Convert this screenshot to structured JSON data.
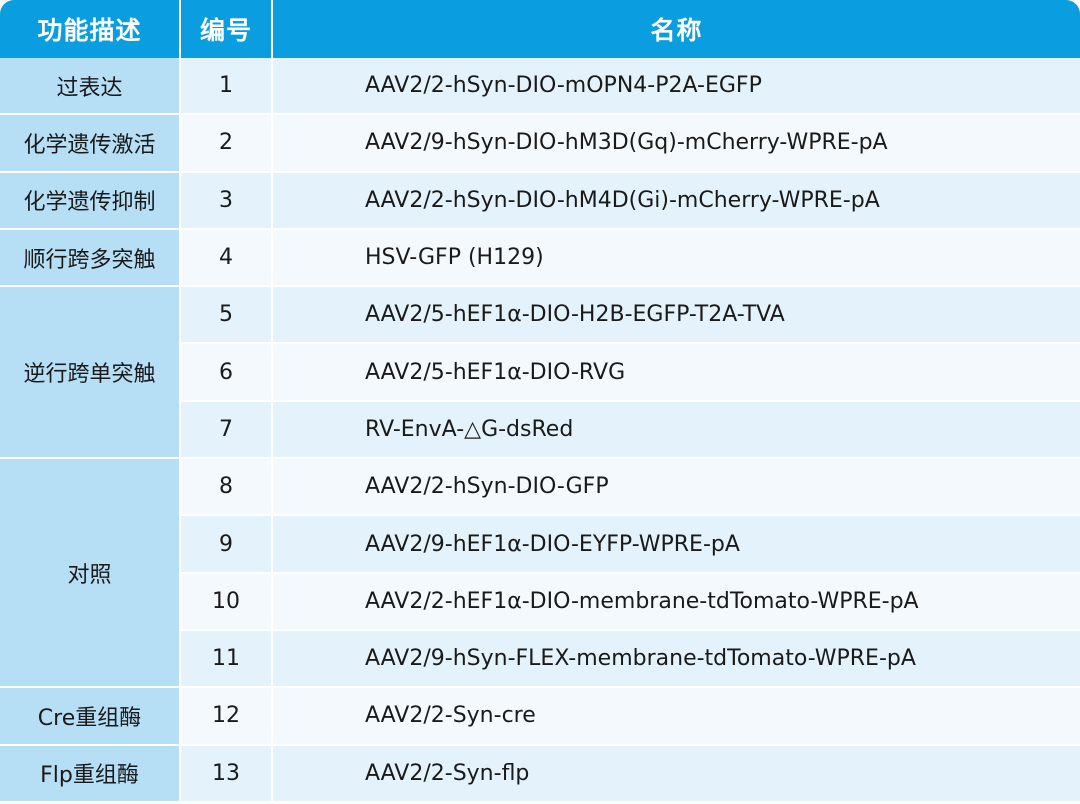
{
  "header": {
    "function_label": "功能描述",
    "number_label": "编号",
    "name_label": "名称"
  },
  "categories": [
    {
      "label": "过表达",
      "rows": 1
    },
    {
      "label": "化学遗传激活",
      "rows": 1
    },
    {
      "label": "化学遗传抑制",
      "rows": 1
    },
    {
      "label": "顺行跨多突触",
      "rows": 1
    },
    {
      "label": "逆行跨单突触",
      "rows": 3
    },
    {
      "label": "对照",
      "rows": 4
    },
    {
      "label": "Cre重组酶",
      "rows": 1
    },
    {
      "label": "Flp重组酶",
      "rows": 1
    }
  ],
  "rows": [
    {
      "no": "1",
      "name": "AAV2/2-hSyn-DIO-mOPN4-P2A-EGFP"
    },
    {
      "no": "2",
      "name": "AAV2/9-hSyn-DIO-hM3D(Gq)-mCherry-WPRE-pA"
    },
    {
      "no": "3",
      "name": "AAV2/2-hSyn-DIO-hM4D(Gi)-mCherry-WPRE-pA"
    },
    {
      "no": "4",
      "name": "HSV-GFP (H129)"
    },
    {
      "no": "5",
      "name": "AAV2/5-hEF1α-DIO-H2B-EGFP-T2A-TVA"
    },
    {
      "no": "6",
      "name": "AAV2/5-hEF1α-DIO-RVG"
    },
    {
      "no": "7",
      "name": "RV-EnvA-△G-dsRed"
    },
    {
      "no": "8",
      "name": "AAV2/2-hSyn-DIO-GFP"
    },
    {
      "no": "9",
      "name": "AAV2/9-hEF1α-DIO-EYFP-WPRE-pA"
    },
    {
      "no": "10",
      "name": "AAV2/2-hEF1α-DIO-membrane-tdTomato-WPRE-pA"
    },
    {
      "no": "11",
      "name": "AAV2/9-hSyn-FLEX-membrane-tdTomato-WPRE-pA"
    },
    {
      "no": "12",
      "name": "AAV2/2-Syn-cre"
    },
    {
      "no": "13",
      "name": "AAV2/2-Syn-flp"
    }
  ],
  "colors": {
    "header_bg": "#0a9de0",
    "category_bg": "#b6dff6",
    "row_odd_bg": "#e3f2fb",
    "row_even_bg": "#f3f9fd"
  }
}
